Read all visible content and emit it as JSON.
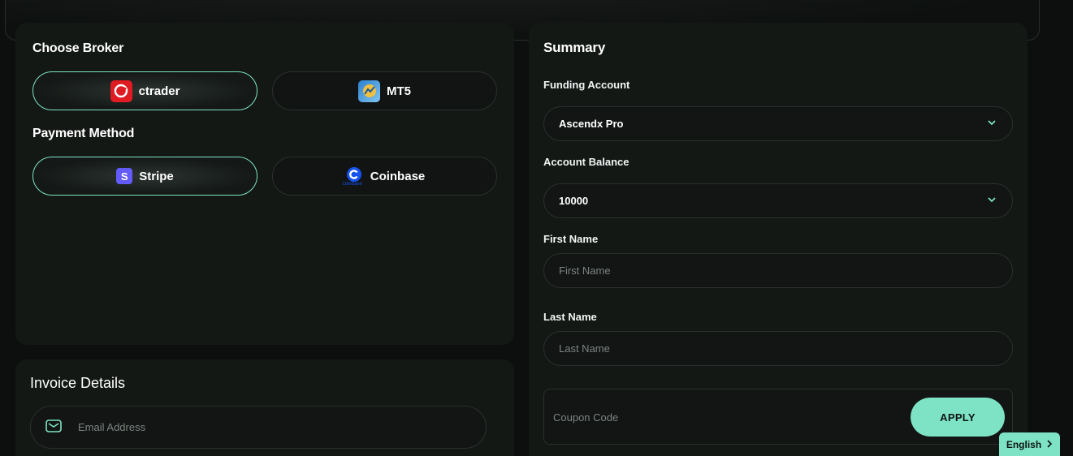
{
  "broker": {
    "title": "Choose Broker",
    "options": [
      {
        "label": "ctrader",
        "selected": true,
        "icon": "ctrader-logo"
      },
      {
        "label": "MT5",
        "selected": false,
        "icon": "mt5-logo"
      }
    ]
  },
  "payment": {
    "title": "Payment Method",
    "options": [
      {
        "label": "Stripe",
        "selected": true,
        "icon": "stripe-logo"
      },
      {
        "label": "Coinbase",
        "selected": false,
        "icon": "coinbase-logo",
        "icon_text": "coinbase"
      }
    ]
  },
  "invoice": {
    "title": "Invoice Details",
    "email_placeholder": "Email Address",
    "email_icon": "mail-icon"
  },
  "summary": {
    "title": "Summary",
    "funding_account": {
      "label": "Funding Account",
      "value": "Ascendx Pro"
    },
    "account_balance": {
      "label": "Account Balance",
      "value": "10000"
    },
    "first_name": {
      "label": "First Name",
      "placeholder": "First Name"
    },
    "last_name": {
      "label": "Last Name",
      "placeholder": "Last Name"
    },
    "coupon": {
      "placeholder": "Coupon Code",
      "apply_label": "APPLY"
    }
  },
  "language": {
    "label": "English"
  },
  "colors": {
    "accent": "#7de3c4",
    "card": "#141815",
    "background": "#0c0f0d"
  }
}
